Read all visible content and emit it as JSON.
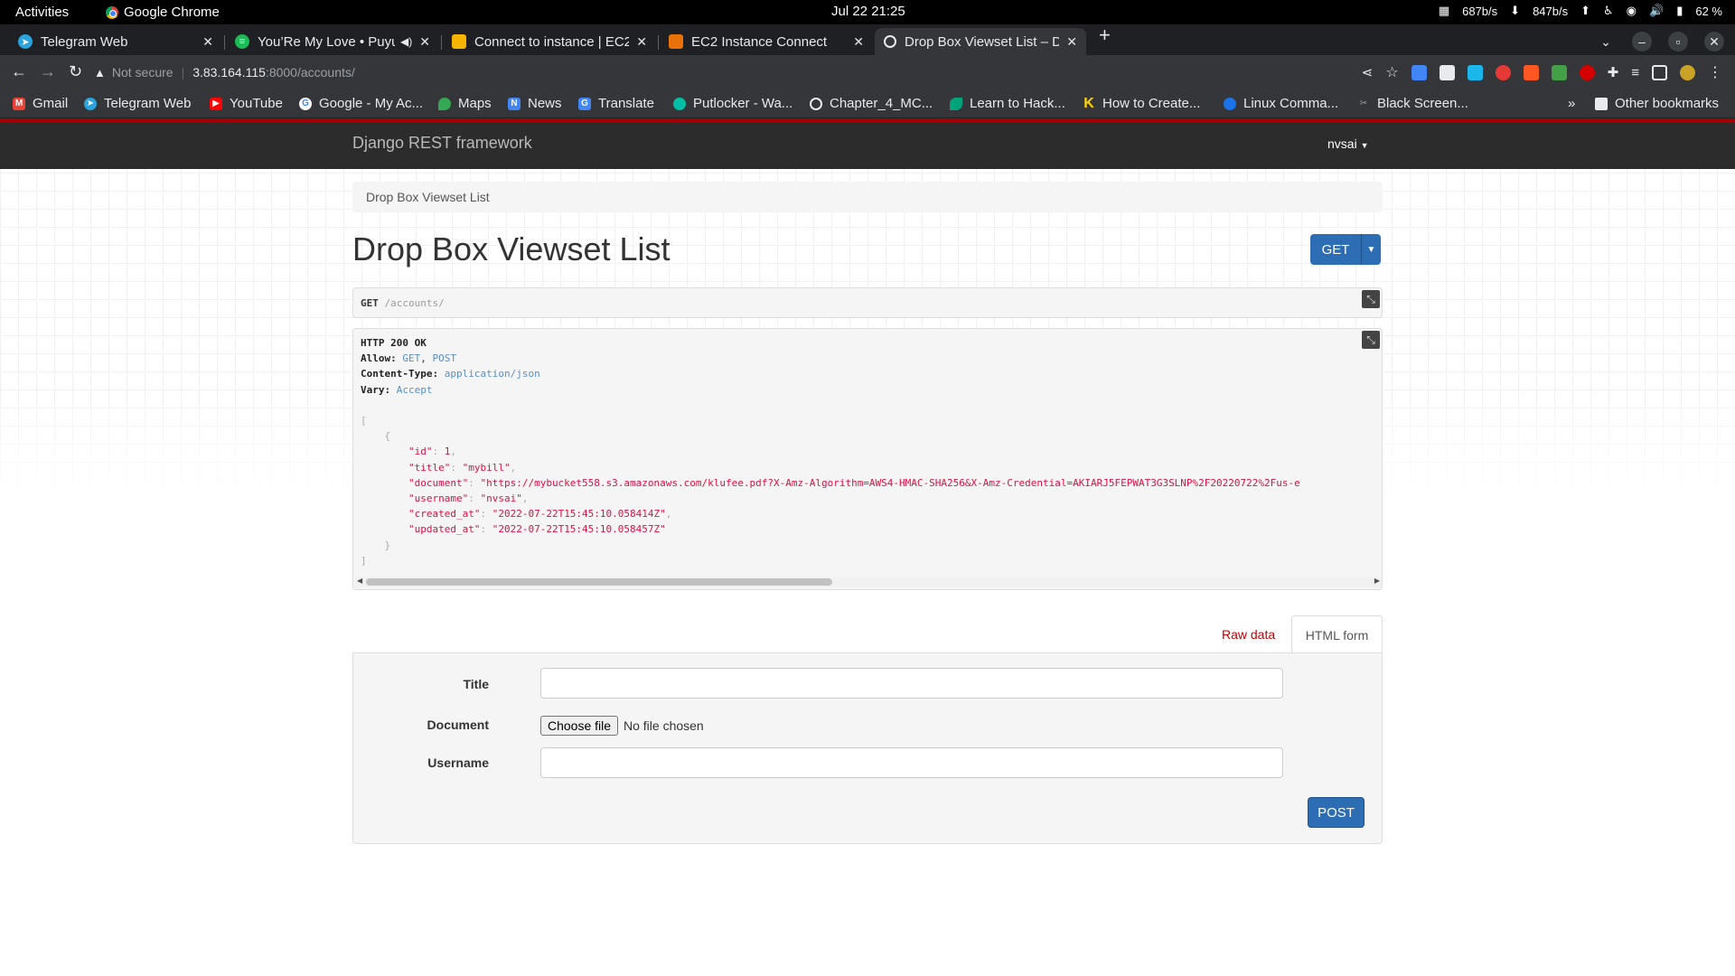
{
  "os": {
    "activities": "Activities",
    "app_name": "Google Chrome",
    "clock": "Jul 22  21:25",
    "net_down": "687b/s",
    "net_up": "847b/s",
    "battery": "62 %"
  },
  "browser": {
    "tabs": [
      {
        "title": "Telegram Web",
        "icon": "telegram-icon",
        "color": "#2aa3df"
      },
      {
        "title": "You’Re My Love • Puyu",
        "icon": "spotify-icon",
        "color": "#1db954"
      },
      {
        "title": "Connect to instance | EC2",
        "icon": "aws-box-icon",
        "color": "#f4b400"
      },
      {
        "title": "EC2 Instance Connect",
        "icon": "aws-cube-icon",
        "color": "#e8710a"
      },
      {
        "title": "Drop Box Viewset List – D",
        "icon": "globe-icon",
        "color": "#ffffff"
      }
    ],
    "security_label": "Not secure",
    "url_host": "3.83.164.115",
    "url_path": ":8000/accounts/",
    "bookmarks": [
      {
        "label": "Gmail",
        "icon": "gmail-icon",
        "color": "#ea4335"
      },
      {
        "label": "Telegram Web",
        "icon": "telegram-icon",
        "color": "#2aa3df"
      },
      {
        "label": "YouTube",
        "icon": "youtube-icon",
        "color": "#ff0000"
      },
      {
        "label": "Google - My Ac...",
        "icon": "google-icon",
        "color": "#4285f4"
      },
      {
        "label": "Maps",
        "icon": "maps-icon",
        "color": "#34a853"
      },
      {
        "label": "News",
        "icon": "news-icon",
        "color": "#4285f4"
      },
      {
        "label": "Translate",
        "icon": "translate-icon",
        "color": "#4285f4"
      },
      {
        "label": "Putlocker - Wa...",
        "icon": "putlocker-icon",
        "color": "#00bfa5"
      },
      {
        "label": "Chapter_4_MC...",
        "icon": "globe-icon",
        "color": "#9aa0a6"
      },
      {
        "label": "Learn to Hack...",
        "icon": "hack-icon",
        "color": "#00a37a"
      },
      {
        "label": "How to Create...",
        "icon": "k-icon",
        "color": "#ffd600"
      },
      {
        "label": "Linux Comma...",
        "icon": "linux-icon",
        "color": "#1a73e8"
      },
      {
        "label": "Black Screen...",
        "icon": "blackscreen-icon",
        "color": "#9aa0a6"
      }
    ],
    "other_bookmarks": "Other bookmarks"
  },
  "app": {
    "brand": "Django REST framework",
    "user": "nvsai",
    "breadcrumb": "Drop Box Viewset List",
    "title": "Drop Box Viewset List",
    "get_label": "GET",
    "request_method": "GET",
    "request_path": "/accounts/",
    "response": {
      "status": "HTTP 200 OK",
      "allow_key": "Allow",
      "allow_get": "GET",
      "allow_post": "POST",
      "ctype_key": "Content-Type",
      "ctype_val": "application/json",
      "vary_key": "Vary",
      "vary_val": "Accept",
      "id": "1",
      "title": "\"mybill\"",
      "document": "\"https://mybucket558.s3.amazonaws.com/klufee.pdf?X-Amz-Algorithm=AWS4-HMAC-SHA256&X-Amz-Credential=AKIARJ5FEPWAT3G3SLNP%2F20220722%2Fus-e",
      "username": "\"nvsai\"",
      "created_at": "\"2022-07-22T15:45:10.058414Z\"",
      "updated_at": "\"2022-07-22T15:45:10.058457Z\""
    },
    "form": {
      "raw_tab": "Raw data",
      "html_tab": "HTML form",
      "title_label": "Title",
      "document_label": "Document",
      "choose_file": "Choose file",
      "no_file": "No file chosen",
      "username_label": "Username",
      "post_label": "POST"
    }
  }
}
